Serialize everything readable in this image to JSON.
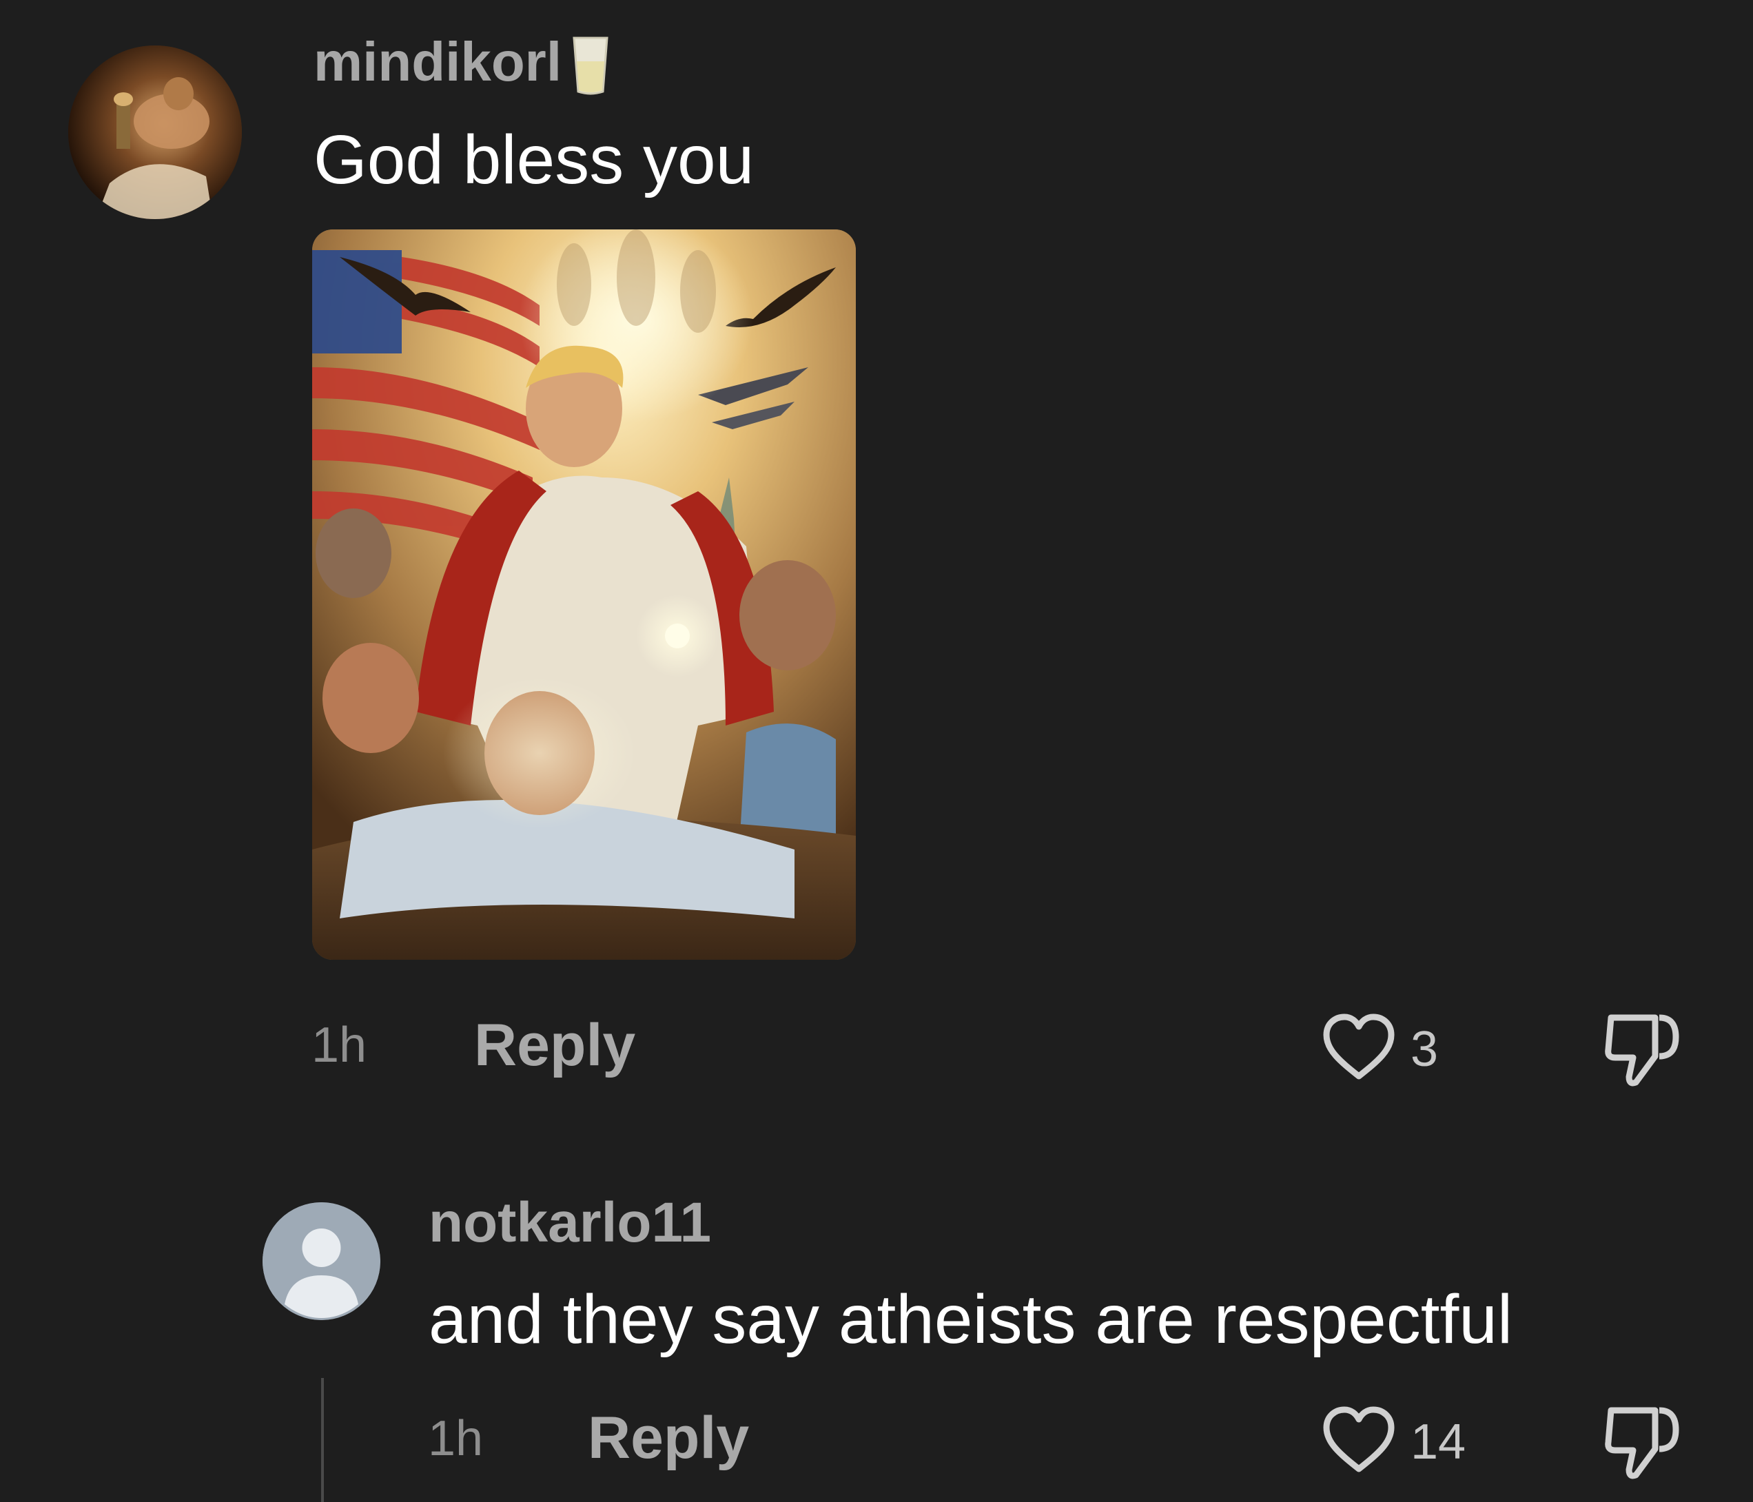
{
  "comments": [
    {
      "username": "mindikorl",
      "badge_icon": "cup-icon",
      "text": "God bless you",
      "has_image_attachment": true,
      "time": "1h",
      "reply_label": "Reply",
      "likes": "3"
    },
    {
      "username": "notkarlo11",
      "text": "and they say atheists are respectful",
      "time": "1h",
      "reply_label": "Reply",
      "likes": "14"
    }
  ],
  "colors": {
    "background": "#1e1e1e",
    "username": "#a7a7a7",
    "body_text": "#ffffff",
    "meta_text": "#8e8e8e",
    "icon_stroke": "#d0d0d0",
    "default_avatar": "#9eaab6"
  }
}
